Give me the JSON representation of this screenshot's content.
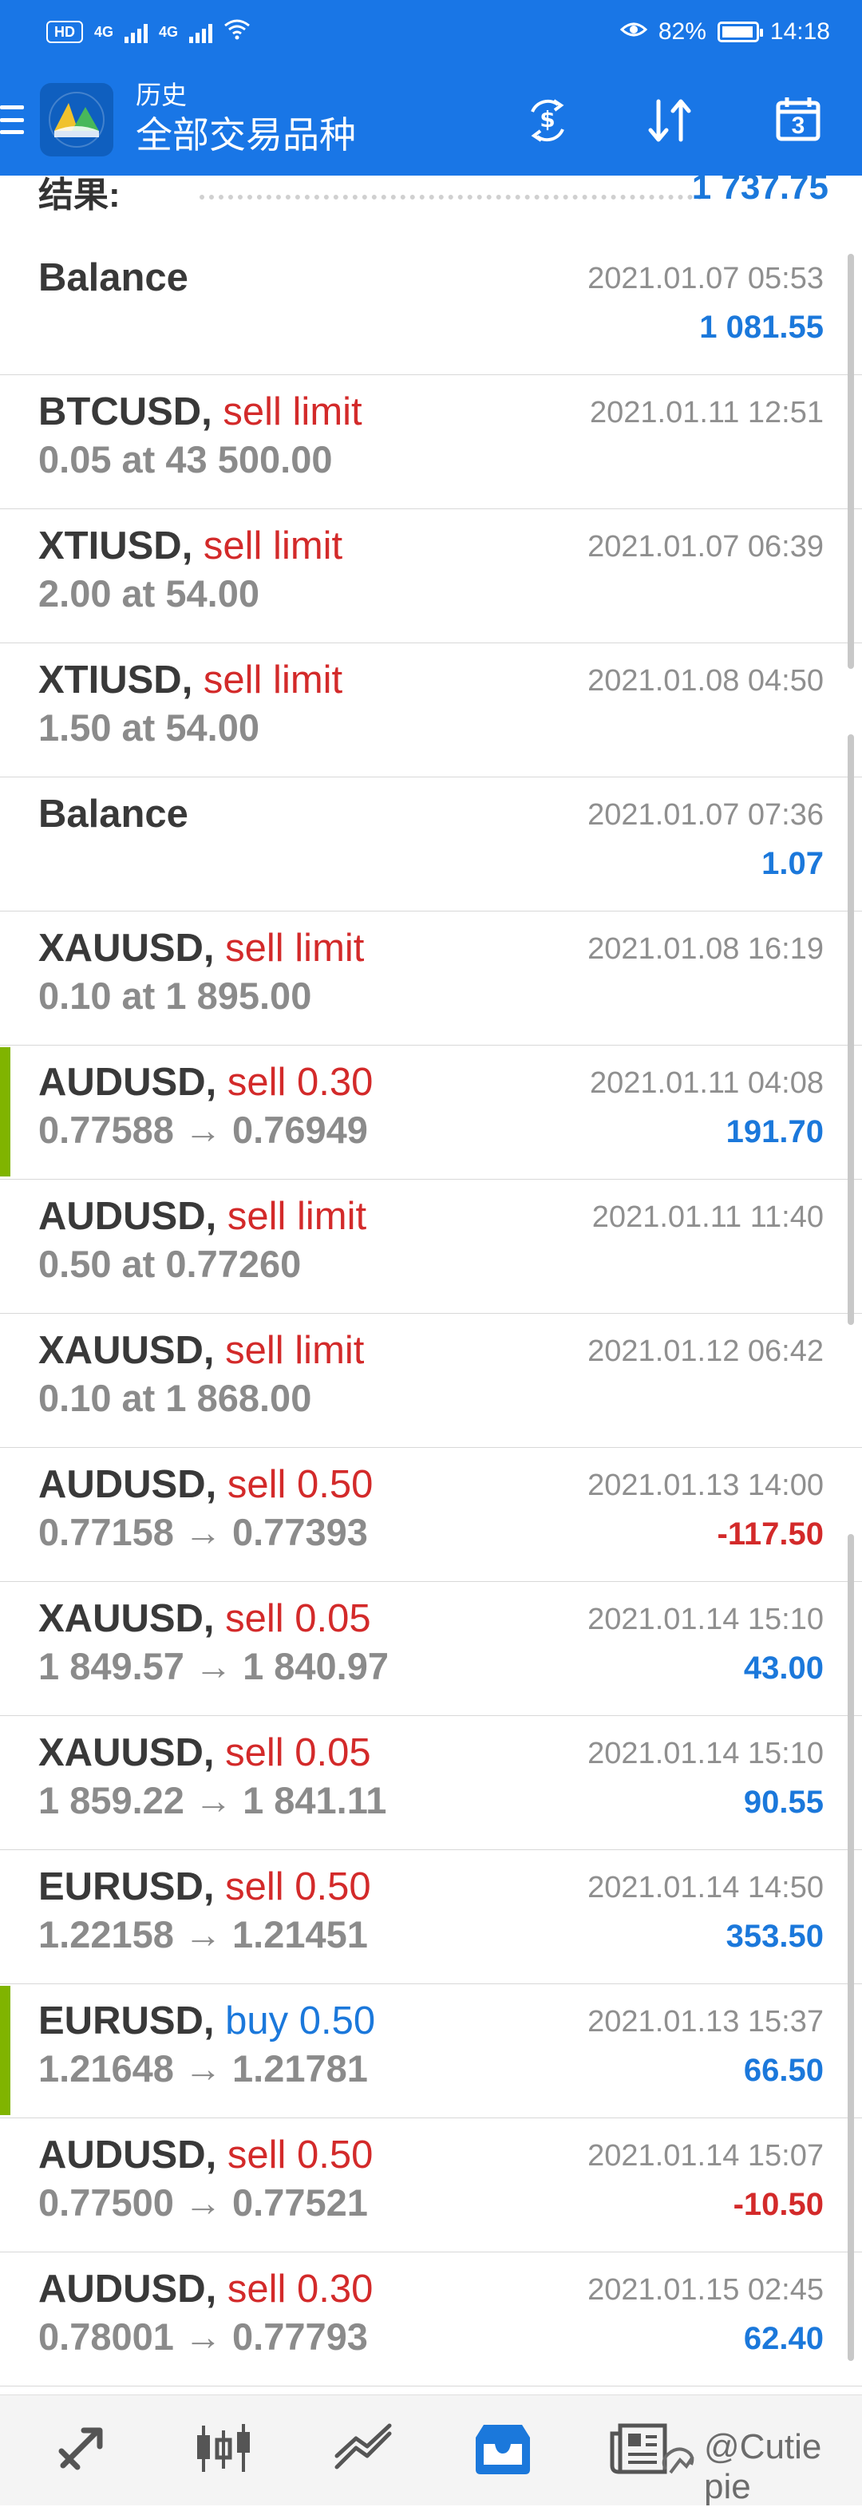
{
  "status_bar": {
    "left_chip": "HD",
    "network_1": "4G",
    "network_2": "4G",
    "battery_text": "82%",
    "battery_level": 0.82,
    "time": "14:18"
  },
  "header": {
    "subtitle": "历史",
    "title": "全部交易品种"
  },
  "summary": {
    "label": "结果:",
    "value": "1 737.75"
  },
  "deals": [
    {
      "symbol": "Balance",
      "action": "",
      "action_type": "",
      "price": "",
      "time": "2021.01.07 05:53",
      "profit": "1 081.55",
      "profit_type": "positive",
      "marker": false
    },
    {
      "symbol": "BTCUSD",
      "action": "sell limit",
      "action_type": "sell",
      "price": "0.05 at 43 500.00",
      "time": "2021.01.11 12:51",
      "profit": "",
      "profit_type": "",
      "marker": false
    },
    {
      "symbol": "XTIUSD",
      "action": "sell limit",
      "action_type": "sell",
      "price": "2.00 at 54.00",
      "time": "2021.01.07 06:39",
      "profit": "",
      "profit_type": "",
      "marker": false
    },
    {
      "symbol": "XTIUSD",
      "action": "sell limit",
      "action_type": "sell",
      "price": "1.50 at 54.00",
      "time": "2021.01.08 04:50",
      "profit": "",
      "profit_type": "",
      "marker": false
    },
    {
      "symbol": "Balance",
      "action": "",
      "action_type": "",
      "price": "",
      "time": "2021.01.07 07:36",
      "profit": "1.07",
      "profit_type": "positive",
      "marker": false
    },
    {
      "symbol": "XAUUSD",
      "action": "sell limit",
      "action_type": "sell",
      "price": "0.10 at 1 895.00",
      "time": "2021.01.08 16:19",
      "profit": "",
      "profit_type": "",
      "marker": false
    },
    {
      "symbol": "AUDUSD",
      "action": "sell 0.30",
      "action_type": "sell",
      "price": "0.77588 → 0.76949",
      "time": "2021.01.11 04:08",
      "profit": "191.70",
      "profit_type": "positive",
      "marker": true
    },
    {
      "symbol": "AUDUSD",
      "action": "sell limit",
      "action_type": "sell",
      "price": "0.50 at 0.77260",
      "time": "2021.01.11 11:40",
      "profit": "",
      "profit_type": "",
      "marker": false
    },
    {
      "symbol": "XAUUSD",
      "action": "sell limit",
      "action_type": "sell",
      "price": "0.10 at 1 868.00",
      "time": "2021.01.12 06:42",
      "profit": "",
      "profit_type": "",
      "marker": false
    },
    {
      "symbol": "AUDUSD",
      "action": "sell 0.50",
      "action_type": "sell",
      "price": "0.77158 → 0.77393",
      "time": "2021.01.13 14:00",
      "profit": "-117.50",
      "profit_type": "negative",
      "marker": false
    },
    {
      "symbol": "XAUUSD",
      "action": "sell 0.05",
      "action_type": "sell",
      "price": "1 849.57 → 1 840.97",
      "time": "2021.01.14 15:10",
      "profit": "43.00",
      "profit_type": "positive",
      "marker": false
    },
    {
      "symbol": "XAUUSD",
      "action": "sell 0.05",
      "action_type": "sell",
      "price": "1 859.22 → 1 841.11",
      "time": "2021.01.14 15:10",
      "profit": "90.55",
      "profit_type": "positive",
      "marker": false
    },
    {
      "symbol": "EURUSD",
      "action": "sell 0.50",
      "action_type": "sell",
      "price": "1.22158 → 1.21451",
      "time": "2021.01.14 14:50",
      "profit": "353.50",
      "profit_type": "positive",
      "marker": false
    },
    {
      "symbol": "EURUSD",
      "action": "buy 0.50",
      "action_type": "buy",
      "price": "1.21648 → 1.21781",
      "time": "2021.01.13 15:37",
      "profit": "66.50",
      "profit_type": "positive",
      "marker": true
    },
    {
      "symbol": "AUDUSD",
      "action": "sell 0.50",
      "action_type": "sell",
      "price": "0.77500 → 0.77521",
      "time": "2021.01.14 15:07",
      "profit": "-10.50",
      "profit_type": "negative",
      "marker": false
    },
    {
      "symbol": "AUDUSD",
      "action": "sell 0.30",
      "action_type": "sell",
      "price": "0.78001 → 0.77793",
      "time": "2021.01.15 02:45",
      "profit": "62.40",
      "profit_type": "positive",
      "marker": false
    }
  ],
  "watermark": "@Cutie pie",
  "colors": {
    "header_blue": "#1976e6",
    "profit_blue": "#1b78db",
    "sell_red": "#d32a2a",
    "marker_green": "#80b400"
  },
  "icons": {
    "menu": "menu-icon",
    "currency_exchange": "currency-exchange-icon",
    "sort": "sort-icon",
    "calendar": "calendar-icon",
    "quotes": "quotes-icon",
    "chart": "chart-icon",
    "trade": "trade-icon",
    "history": "history-icon",
    "news": "news-icon"
  },
  "toolbar": {
    "calendar_day": "3"
  }
}
